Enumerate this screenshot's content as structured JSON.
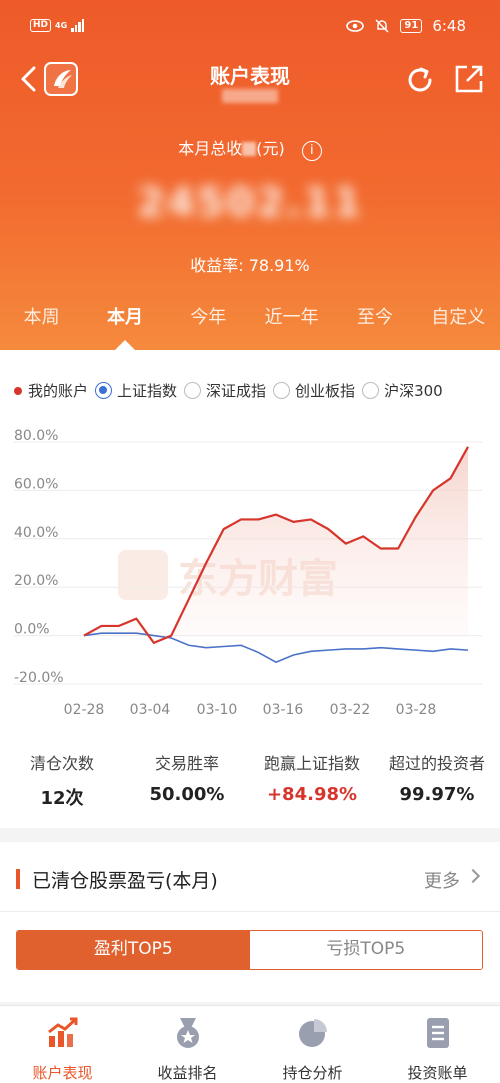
{
  "status_bar": {
    "hd": "HD",
    "network": "4G",
    "battery": "91",
    "time": "6:48"
  },
  "nav": {
    "title": "账户表现"
  },
  "summary": {
    "total_label_prefix": "本月总收",
    "total_label_suffix": "(元)",
    "total_value": "24502.11",
    "rate_label": "收益率: 78.91%"
  },
  "period_tabs": [
    "本周",
    "本月",
    "今年",
    "近一年",
    "至今",
    "自定义"
  ],
  "period_tab_active": "本月",
  "legend": {
    "my_account": "我的账户",
    "options": [
      "上证指数",
      "深证成指",
      "创业板指",
      "沪深300"
    ],
    "selected": "上证指数"
  },
  "colors": {
    "brand": "#ee5a2a",
    "account_line": "#d7352b",
    "index_line": "#4a72c8",
    "accent_tab": "#e0602e"
  },
  "watermark": "东方财富",
  "chart_data": {
    "type": "line",
    "y_ticks": [
      "80.0%",
      "60.0%",
      "40.0%",
      "20.0%",
      "0.0%",
      "-20.0%"
    ],
    "x_ticks": [
      "02-28",
      "03-04",
      "03-10",
      "03-16",
      "03-22",
      "03-28"
    ],
    "ylim": [
      -20,
      80
    ],
    "grid": true,
    "series": [
      {
        "name": "我的账户",
        "values": [
          0,
          4,
          4,
          7,
          -3,
          0,
          15,
          30,
          44,
          48,
          48,
          50,
          47,
          48,
          44,
          38,
          41,
          36,
          36,
          49,
          60,
          65,
          78
        ]
      },
      {
        "name": "上证指数",
        "values": [
          0,
          1,
          1,
          1,
          0,
          -1,
          -4,
          -5,
          -4.5,
          -4,
          -7,
          -11,
          -8,
          -6.5,
          -6,
          -5.5,
          -5.5,
          -5,
          -5.5,
          -6,
          -6.5,
          -5.5,
          -6
        ]
      }
    ]
  },
  "stats": [
    {
      "label": "清仓次数",
      "value": "12次"
    },
    {
      "label": "交易胜率",
      "value": "50.00%"
    },
    {
      "label": "跑赢上证指数",
      "value": "+84.98%"
    },
    {
      "label": "超过的投资者",
      "value": "99.97%"
    }
  ],
  "section": {
    "title": "已清仓股票盈亏(本月)",
    "more": "更多"
  },
  "segments": {
    "profit": "盈利TOP5",
    "loss": "亏损TOP5"
  },
  "bottom_nav": [
    "账户表现",
    "收益排名",
    "持仓分析",
    "投资账单"
  ]
}
